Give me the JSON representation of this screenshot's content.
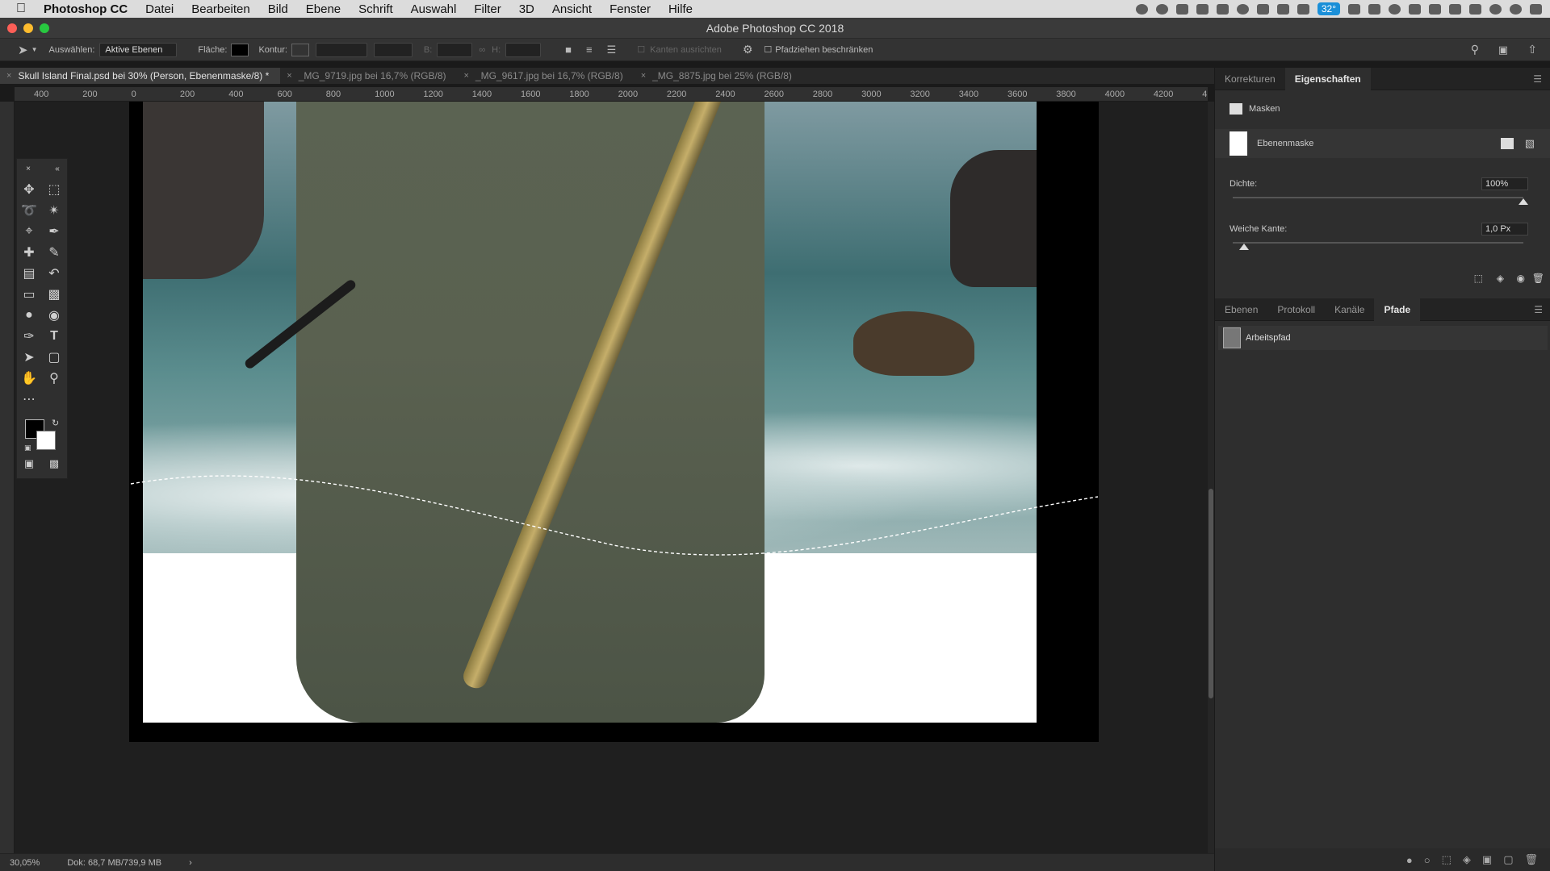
{
  "mac_menu": {
    "app_name": "Photoshop CC",
    "items": [
      "Datei",
      "Bearbeiten",
      "Bild",
      "Ebene",
      "Schrift",
      "Auswahl",
      "Filter",
      "3D",
      "Ansicht",
      "Fenster",
      "Hilfe"
    ],
    "temperature": "32°"
  },
  "window_title": "Adobe Photoshop CC 2018",
  "options_bar": {
    "select_label": "Auswählen:",
    "select_value": "Aktive Ebenen",
    "fill_label": "Fläche:",
    "stroke_label": "Kontur:",
    "width_label": "B:",
    "height_label": "H:",
    "align_edges": "Kanten ausrichten",
    "constrain_path": "Pfadziehen beschränken"
  },
  "doc_tabs": [
    {
      "label": "Skull Island Final.psd bei 30% (Person, Ebenenmaske/8) *",
      "active": true
    },
    {
      "label": "_MG_9719.jpg bei 16,7% (RGB/8)",
      "active": false
    },
    {
      "label": "_MG_9617.jpg bei 16,7% (RGB/8)",
      "active": false
    },
    {
      "label": "_MG_8875.jpg bei 25% (RGB/8)",
      "active": false
    }
  ],
  "ruler_labels": [
    "400",
    "200",
    "0",
    "200",
    "400",
    "600",
    "800",
    "1000",
    "1200",
    "1400",
    "1600",
    "1800",
    "2000",
    "2200",
    "2400",
    "2600",
    "2800",
    "3000",
    "3200",
    "3400",
    "3600",
    "3800",
    "4000",
    "4200",
    "4"
  ],
  "properties_panel": {
    "tabs": [
      "Korrekturen",
      "Eigenschaften"
    ],
    "active_tab": "Eigenschaften",
    "section": "Masken",
    "mask_type": "Ebenenmaske",
    "density_label": "Dichte:",
    "density_value": "100%",
    "density_level": 1.0,
    "feather_label": "Weiche Kante:",
    "feather_value": "1,0 Px",
    "feather_level": 0.04
  },
  "layers_panel": {
    "tabs": [
      "Ebenen",
      "Protokoll",
      "Kanäle",
      "Pfade"
    ],
    "active_tab": "Pfade",
    "paths": [
      {
        "name": "Arbeitspfad"
      }
    ]
  },
  "status": {
    "zoom": "30,05%",
    "doc_size": "Dok: 68,7 MB/739,9 MB",
    "arrow": "›"
  },
  "colors": {
    "foreground": "#000000",
    "background": "#ffffff",
    "accent": "#1a8fd8"
  }
}
